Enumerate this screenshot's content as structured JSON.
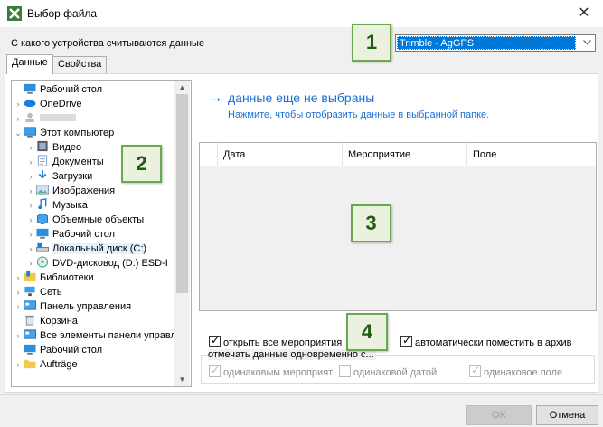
{
  "window": {
    "title": "Выбор файла",
    "close_glyph": "✕"
  },
  "device": {
    "label": "С какого устройства считываются данные",
    "selected": "Trimble - AgGPS"
  },
  "tabs": [
    {
      "label": "Данные",
      "active": true
    },
    {
      "label": "Свойства",
      "active": false
    }
  ],
  "tree": {
    "items": [
      {
        "label": "Рабочий стол",
        "level": 0,
        "icon": "desktop-icon",
        "chev": ""
      },
      {
        "label": "OneDrive",
        "level": 1,
        "icon": "cloud-icon",
        "chev": "›"
      },
      {
        "label": "",
        "level": 1,
        "icon": "user-icon",
        "chev": "›"
      },
      {
        "label": "Этот компьютер",
        "level": 1,
        "icon": "computer-icon",
        "chev": "⌄"
      },
      {
        "label": "Видео",
        "level": 2,
        "icon": "video-icon",
        "chev": "›"
      },
      {
        "label": "Документы",
        "level": 2,
        "icon": "documents-icon",
        "chev": "›"
      },
      {
        "label": "Загрузки",
        "level": 2,
        "icon": "downloads-icon",
        "chev": "›"
      },
      {
        "label": "Изображения",
        "level": 2,
        "icon": "images-icon",
        "chev": "›"
      },
      {
        "label": "Музыка",
        "level": 2,
        "icon": "music-icon",
        "chev": "›"
      },
      {
        "label": "Объемные объекты",
        "level": 2,
        "icon": "3d-objects-icon",
        "chev": "›"
      },
      {
        "label": "Рабочий стол",
        "level": 2,
        "icon": "desktop-icon",
        "chev": "›"
      },
      {
        "label": "Локальный диск (C:)",
        "level": 2,
        "icon": "drive-icon",
        "chev": "›",
        "selected": true
      },
      {
        "label": "DVD-дисковод (D:) ESD-I",
        "level": 2,
        "icon": "dvd-icon",
        "chev": "›"
      },
      {
        "label": "Библиотеки",
        "level": 1,
        "icon": "libraries-icon",
        "chev": "›"
      },
      {
        "label": "Сеть",
        "level": 1,
        "icon": "network-icon",
        "chev": "›"
      },
      {
        "label": "Панель управления",
        "level": 1,
        "icon": "control-panel-icon",
        "chev": "›"
      },
      {
        "label": "Корзина",
        "level": 1,
        "icon": "recycle-bin-icon",
        "chev": ""
      },
      {
        "label": "Все элементы панели управл",
        "level": 1,
        "icon": "control-panel-icon",
        "chev": "›"
      },
      {
        "label": "Рабочий стол",
        "level": 1,
        "icon": "desktop-icon",
        "chev": ""
      },
      {
        "label": "Aufträge",
        "level": 1,
        "icon": "folder-icon",
        "chev": "›"
      }
    ]
  },
  "main": {
    "arrow": "→",
    "no_data": "данные еще не выбраны",
    "hint": "Нажмите, чтобы отобразить данные в выбранной папке.",
    "columns": [
      "Дата",
      "Мероприятие",
      "Поле"
    ]
  },
  "options": {
    "open_all": {
      "label": "открыть все мероприятия",
      "checked": true
    },
    "auto_archive": {
      "label": "автоматически поместить в архив",
      "checked": true
    },
    "mark_label": "отмечать данные одновременно с...",
    "same_event": {
      "label": "одинаковым мероприят",
      "checked": true
    },
    "same_date": {
      "label": "одинаковой датой",
      "checked": false
    },
    "same_field": {
      "label": "одинаковое поле",
      "checked": true
    },
    "check_glyph": "✓"
  },
  "buttons": {
    "ok": "OK",
    "cancel": "Отмена"
  },
  "callouts": [
    "1",
    "2",
    "3",
    "4"
  ],
  "colors": {
    "accent": "#0078d7",
    "link": "#1a6fd4",
    "callout_border": "#6aa84f",
    "callout_fill": "#ebf1de"
  }
}
